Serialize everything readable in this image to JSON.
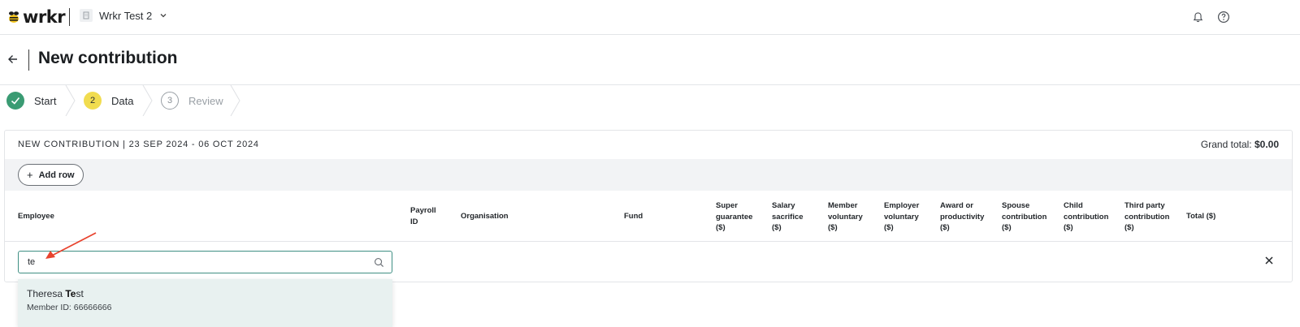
{
  "app": {
    "logo_text": "wrkr",
    "org_name": "Wrkr Test 2"
  },
  "icons": {
    "back": "arrow-left-icon",
    "bell": "bell-icon",
    "help": "help-icon",
    "chevron": "chevron-down-icon",
    "search": "search-icon",
    "close": "close-icon",
    "plus": "plus-icon",
    "check": "check-icon"
  },
  "page": {
    "title": "New contribution"
  },
  "steps": [
    {
      "label": "Start",
      "number": "",
      "state": "done"
    },
    {
      "label": "Data",
      "number": "2",
      "state": "active"
    },
    {
      "label": "Review",
      "number": "3",
      "state": "upcoming"
    }
  ],
  "card": {
    "title": "NEW CONTRIBUTION | 23 SEP 2024 - 06 OCT 2024",
    "grand_total_label": "Grand total:",
    "grand_total_value": "$0.00",
    "add_row_label": "Add row"
  },
  "table": {
    "columns": {
      "employee": "Employee",
      "payroll_id_1": "Payroll",
      "payroll_id_2": "ID",
      "organisation": "Organisation",
      "fund": "Fund",
      "super_1": "Super",
      "super_2": "guarantee",
      "super_3": "($)",
      "salary_1": "Salary",
      "salary_2": "sacrifice",
      "salary_3": "($)",
      "member_1": "Member",
      "member_2": "voluntary",
      "member_3": "($)",
      "employer_1": "Employer",
      "employer_2": "voluntary",
      "employer_3": "($)",
      "award_1": "Award or",
      "award_2": "productivity",
      "award_3": "($)",
      "spouse_1": "Spouse",
      "spouse_2": "contribution",
      "spouse_3": "($)",
      "child_1": "Child",
      "child_2": "contribution",
      "child_3": "($)",
      "third_1": "Third party",
      "third_2": "contribution",
      "third_3": "($)",
      "total": "Total ($)"
    },
    "search_value": "te"
  },
  "dropdown": {
    "results": [
      {
        "name_prefix": "Theresa ",
        "name_match": "Te",
        "name_suffix": "st",
        "member_id": "Member ID: 66666666"
      }
    ]
  },
  "colors": {
    "step_done": "#3a9b73",
    "step_active": "#f1dc4f",
    "search_border": "#3f8f83",
    "dropdown_bg": "#e8f1f0",
    "annotation": "#e8432e"
  }
}
